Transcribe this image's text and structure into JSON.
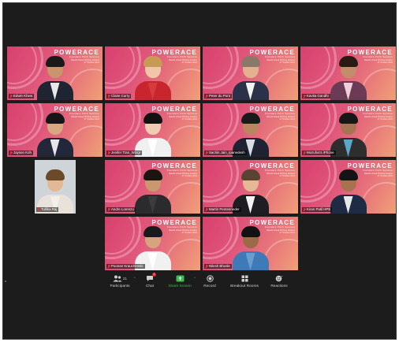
{
  "brand": {
    "logo": "POWERACE",
    "subtitle": "Founders Pitch Session",
    "tagline": "Rebuilt Virtual Pitching Session",
    "date": "27 October 2021"
  },
  "participants": [
    {
      "name": "Edwin Khew",
      "muted": true,
      "style": "brand",
      "skin": "#c9956c",
      "hair": "#1a1a1a",
      "suit": "#1f2433",
      "shirt": "#e8e8e8"
    },
    {
      "name": "Claire Curry",
      "muted": true,
      "style": "brand",
      "skin": "#efc7a8",
      "hair": "#c79a55",
      "suit": "#c8252f",
      "shirt": "#d43b3b"
    },
    {
      "name": "Peter du Pont",
      "muted": true,
      "style": "brand",
      "skin": "#e4b08f",
      "hair": "#8a7868",
      "suit": "#2a3148",
      "shirt": "#f2f2f2"
    },
    {
      "name": "Kavita Gandhi",
      "muted": true,
      "style": "brand",
      "skin": "#c38d6a",
      "hair": "#2a1a14",
      "suit": "#6b3a55",
      "shirt": "#f0d0d8"
    },
    {
      "name": "Jayson Koh",
      "muted": true,
      "style": "brand",
      "skin": "#d8a981",
      "hair": "#161616",
      "suit": "#23273a",
      "shirt": "#e6e6e6"
    },
    {
      "name": "Jenifer Tran_Wzrgr",
      "muted": true,
      "style": "brand",
      "skin": "#f0cdb2",
      "hair": "#121212",
      "suit": "#f0f0f0",
      "shirt": "#ffffff"
    },
    {
      "name": "Sachin Jain_Ipanedesh",
      "muted": true,
      "style": "brand",
      "skin": "#b9865f",
      "hair": "#1a1a1a",
      "suit": "#1f2233",
      "shirt": "#d9dde6"
    },
    {
      "name": "Mozufus's iPhone",
      "muted": true,
      "style": "brand",
      "skin": "#a67453",
      "hair": "#171717",
      "suit": "#2e2e2e",
      "shirt": "#5aa7c9"
    },
    {
      "name": "Tullika Raj",
      "muted": true,
      "style": "pale",
      "skin": "#e3b895",
      "hair": "#6b4a2b",
      "suit": "#e8e2da",
      "shirt": "#f4efe8"
    },
    {
      "name": "Andre Lorenzo",
      "muted": true,
      "style": "brand",
      "skin": "#c9986f",
      "hair": "#1b1410",
      "suit": "#2b2b2e",
      "shirt": "#3b3b3b"
    },
    {
      "name": "Martin Pentenrieder",
      "muted": true,
      "style": "brand",
      "skin": "#e7b895",
      "hair": "#5a4330",
      "suit": "#1e1e22",
      "shirt": "#f3f3f3"
    },
    {
      "name": "Kiran Patil HPE",
      "muted": true,
      "style": "brand",
      "skin": "#a8724e",
      "hair": "#141414",
      "suit": "#1f2a44",
      "shirt": "#e8e8e8"
    },
    {
      "name": "Poonan Krauchenski",
      "muted": true,
      "style": "brand",
      "skin": "#d6a47f",
      "hair": "#1a1a1a",
      "suit": "#f1f1f1",
      "shirt": "#ffffff"
    },
    {
      "name": "Nilesh Bhosle",
      "muted": true,
      "style": "brand",
      "skin": "#9b6a48",
      "hair": "#121212",
      "suit": "#3f7ab8",
      "shirt": "#6a9ccc"
    }
  ],
  "toolbar": {
    "participants_label": "Participants",
    "participants_count": "21",
    "chat_label": "Chat",
    "chat_badge": "1",
    "share_label": "Share Screen",
    "record_label": "Record",
    "breakout_label": "Breakout Rooms",
    "reactions_label": "Reactions"
  },
  "colors": {
    "share_green": "#36c04a",
    "mute_red": "#e23b3b",
    "window_bg": "#1c1c1c"
  }
}
